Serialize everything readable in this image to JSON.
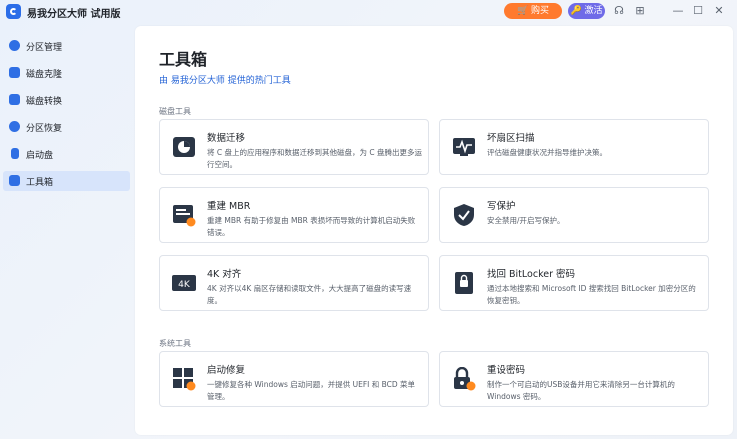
{
  "app": {
    "title": "易我分区大师 试用版",
    "buy_label": "购买",
    "activate_label": "激活"
  },
  "sidebar": {
    "items": [
      {
        "label": "分区管理",
        "icon": "pie-icon",
        "active": false
      },
      {
        "label": "磁盘克隆",
        "icon": "clone-icon",
        "active": false
      },
      {
        "label": "磁盘转换",
        "icon": "convert-icon",
        "active": false
      },
      {
        "label": "分区恢复",
        "icon": "recover-icon",
        "active": false
      },
      {
        "label": "启动盘",
        "icon": "usb-icon",
        "active": false
      },
      {
        "label": "工具箱",
        "icon": "toolbox-icon",
        "active": true
      }
    ]
  },
  "main": {
    "title": "工具箱",
    "provider": "由 易我分区大师 提供的热门工具",
    "disk_tools_label": "磁盘工具",
    "system_tools_label": "系统工具",
    "tools": [
      {
        "title": "数据迁移",
        "desc": "将 C 盘上的应用程序和数据迁移到其他磁盘，为 C 盘腾出更多运行空间。",
        "icon": "data-migrate-icon"
      },
      {
        "title": "坏扇区扫描",
        "desc": "评估磁盘健康状况并指导维护决策。",
        "icon": "bad-sector-scan-icon"
      },
      {
        "title": "重建 MBR",
        "desc": "重建 MBR 有助于修复由 MBR 表损坏而导致的计算机启动失败错误。",
        "icon": "rebuild-mbr-icon"
      },
      {
        "title": "写保护",
        "desc": "安全禁用/开启写保护。",
        "icon": "write-protect-icon"
      },
      {
        "title": "4K 对齐",
        "desc": "4K 对齐以4K 扇区存储和读取文件，大大提高了磁盘的读写速度。",
        "icon": "4k-align-icon"
      },
      {
        "title": "找回 BitLocker 密码",
        "desc": "通过本地搜索和 Microsoft ID 搜索找回 BitLocker 加密分区的恢复密钥。",
        "icon": "bitlocker-icon"
      },
      {
        "title": "启动修复",
        "desc": "一键修复各种 Windows 启动问题，并提供 UEFI 和 BCD 菜单管理。",
        "icon": "boot-repair-icon"
      },
      {
        "title": "重设密码",
        "desc": "制作一个可启动的USB设备并用它来清除另一台计算机的Windows 密码。",
        "icon": "reset-password-icon"
      }
    ]
  },
  "colors": {
    "accent": "#2f6fe4",
    "buy": "#ff7a2e",
    "activate": "#6f6be8",
    "icon_dark": "#2b3646"
  }
}
